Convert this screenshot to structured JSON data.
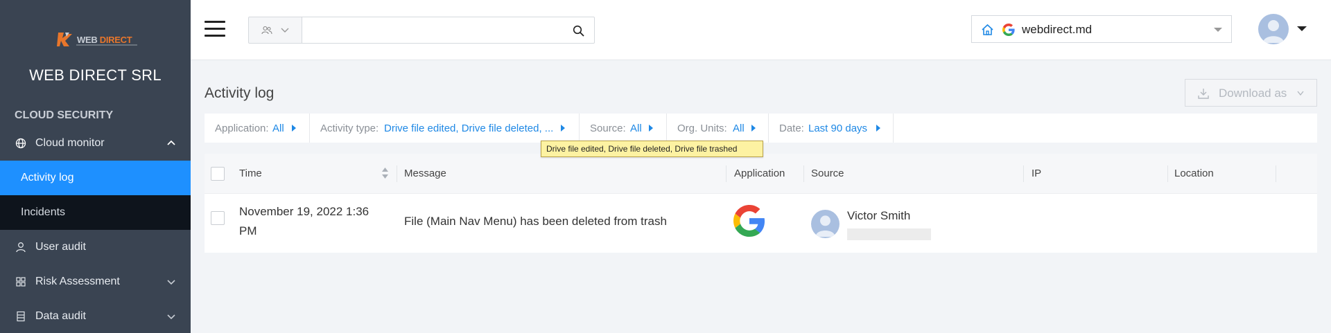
{
  "sidebar": {
    "logo": {
      "text_a": "WEB",
      "text_b": " DIRECT",
      "icon": "webdirect-logo-icon"
    },
    "company_name": "WEB DIRECT SRL",
    "section_title": "CLOUD SECURITY",
    "cloud_monitor": {
      "label": "Cloud monitor",
      "icon": "globe-icon"
    },
    "activity_log": {
      "label": "Activity log"
    },
    "incidents": {
      "label": "Incidents"
    },
    "user_audit": {
      "label": "User audit",
      "icon": "user-icon"
    },
    "risk_assessment": {
      "label": "Risk Assessment",
      "icon": "grid-icon"
    },
    "data_audit": {
      "label": "Data audit",
      "icon": "database-icon"
    }
  },
  "header": {
    "search": {
      "placeholder": "",
      "scope_icon": "users-icon"
    },
    "domain": {
      "value": "webdirect.md",
      "home_icon": "home-icon",
      "provider_icon": "google-icon"
    },
    "account_icon": "avatar-icon"
  },
  "main": {
    "title": "Activity log",
    "download_label": "Download as",
    "filters": {
      "application": {
        "key": "Application:",
        "value": "All"
      },
      "activity_type": {
        "key": "Activity type:",
        "value": "Drive file edited, Drive file deleted, ..."
      },
      "source": {
        "key": "Source:",
        "value": "All"
      },
      "org_units": {
        "key": "Org. Units:",
        "value": "All"
      },
      "date": {
        "key": "Date:",
        "value": "Last 90 days"
      }
    },
    "tooltip": "Drive file edited, Drive file deleted, Drive file trashed",
    "table": {
      "columns": {
        "time": "Time",
        "message": "Message",
        "application": "Application",
        "source": "Source",
        "ip": "IP",
        "location": "Location"
      },
      "rows": [
        {
          "time": "November 19, 2022 1:36 PM",
          "message": "File (Main Nav Menu) has been deleted from trash",
          "application_icon": "google-icon",
          "source_name": "Victor Smith",
          "ip": "",
          "location": ""
        }
      ]
    }
  },
  "colors": {
    "accent": "#1e90ff",
    "sidebar_bg": "#3a4452",
    "link": "#1e88e5",
    "tooltip_bg": "#fdf2a2"
  }
}
